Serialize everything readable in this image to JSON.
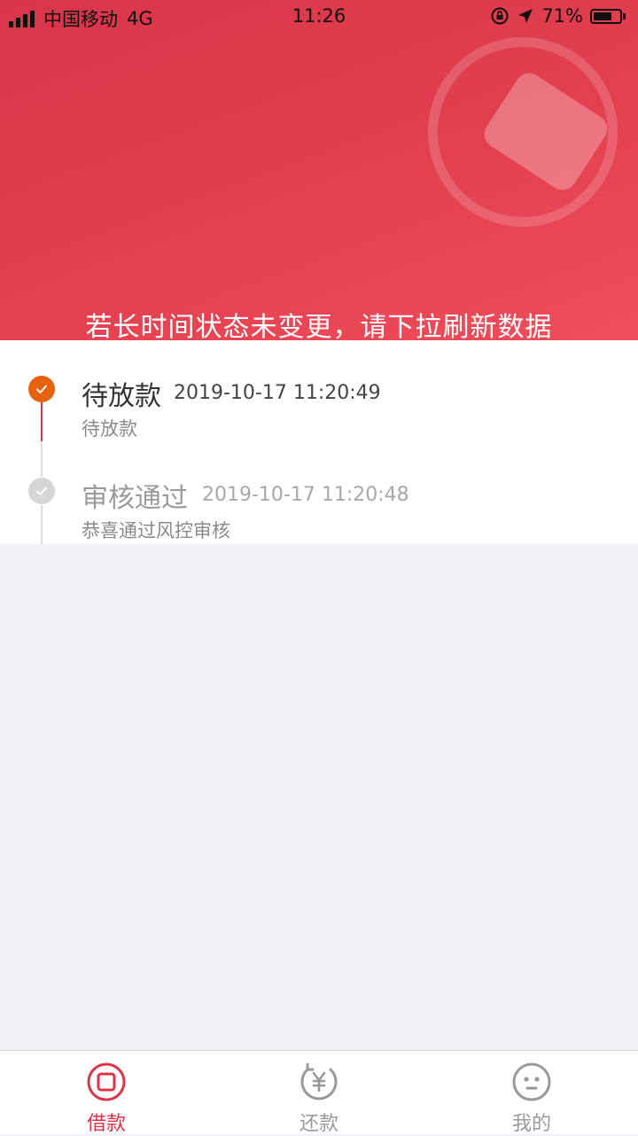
{
  "status_bar": {
    "carrier": "中国移动",
    "network": "4G",
    "time": "11:26",
    "battery": "71%",
    "battery_level": 0.71
  },
  "header": {
    "notice": "若长时间状态未变更，请下拉刷新数据",
    "color": "#e2404f"
  },
  "timeline": [
    {
      "title": "待放款",
      "time": "2019-10-17 11:20:49",
      "desc": "待放款",
      "status": "current",
      "dot_color": "#e5620f"
    },
    {
      "title": "审核通过",
      "time": "2019-10-17 11:20:48",
      "desc": "恭喜通过风控审核",
      "status": "done",
      "dot_color": "#d6d6d6"
    }
  ],
  "tabbar": {
    "active_color": "#dd3346",
    "inactive_color": "#999999",
    "tabs": [
      {
        "label": "借款",
        "icon": "loan-icon",
        "active": true
      },
      {
        "label": "还款",
        "icon": "repay-yen-icon",
        "active": false
      },
      {
        "label": "我的",
        "icon": "face-icon",
        "active": false
      }
    ]
  }
}
